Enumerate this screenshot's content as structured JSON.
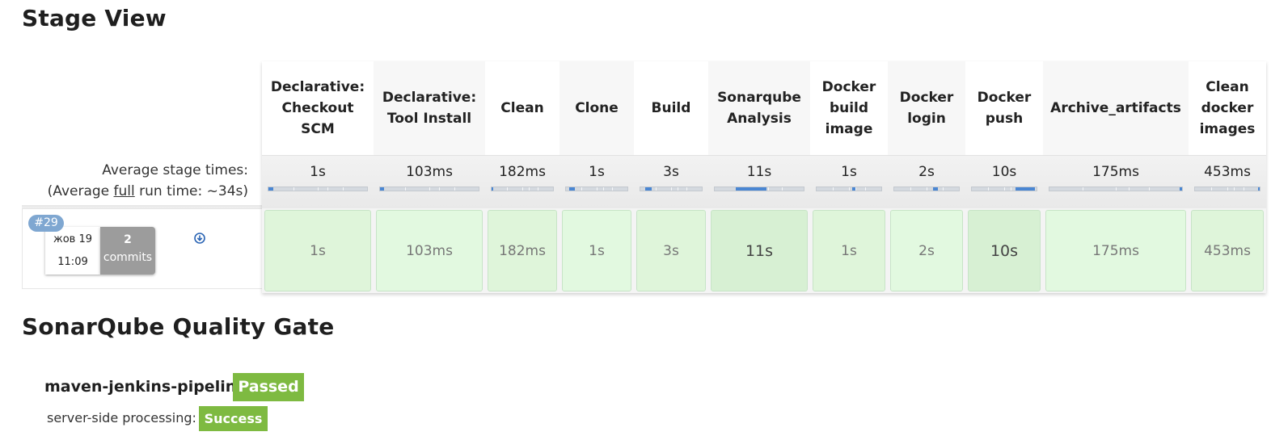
{
  "stage_view": {
    "title": "Stage View",
    "avg_label": "Average stage times:",
    "avg_full_prefix": "(Average ",
    "avg_full_link": "full",
    "avg_full_suffix": " run time: ~34s)",
    "stages": [
      {
        "name": "Declarative: Checkout SCM",
        "avg": "1s",
        "build_time": "1s"
      },
      {
        "name": "Declarative: Tool Install",
        "avg": "103ms",
        "build_time": "103ms"
      },
      {
        "name": "Clean",
        "avg": "182ms",
        "build_time": "182ms"
      },
      {
        "name": "Clone",
        "avg": "1s",
        "build_time": "1s"
      },
      {
        "name": "Build",
        "avg": "3s",
        "build_time": "3s"
      },
      {
        "name": "Sonarqube Analysis",
        "avg": "11s",
        "build_time": "11s"
      },
      {
        "name": "Docker build image",
        "avg": "1s",
        "build_time": "1s"
      },
      {
        "name": "Docker login",
        "avg": "2s",
        "build_time": "2s"
      },
      {
        "name": "Docker push",
        "avg": "10s",
        "build_time": "10s"
      },
      {
        "name": "Archive_artifacts",
        "avg": "175ms",
        "build_time": "175ms"
      },
      {
        "name": "Clean docker images",
        "avg": "453ms",
        "build_time": "453ms"
      }
    ],
    "build": {
      "number": "#29",
      "date": "жов 19",
      "time": "11:09",
      "commits_count": "2",
      "commits_label": "commits"
    }
  },
  "sonarqube": {
    "title": "SonarQube Quality Gate",
    "project": "maven-jenkins-pipeline",
    "status": "Passed",
    "processing_label": "server-side processing:",
    "processing_status": "Success"
  },
  "colors": {
    "success_green": "#7eba41",
    "cell_green": "#e2f9e0",
    "progress_blue": "#4a86d2",
    "badge_blue": "#7fa7d1"
  }
}
